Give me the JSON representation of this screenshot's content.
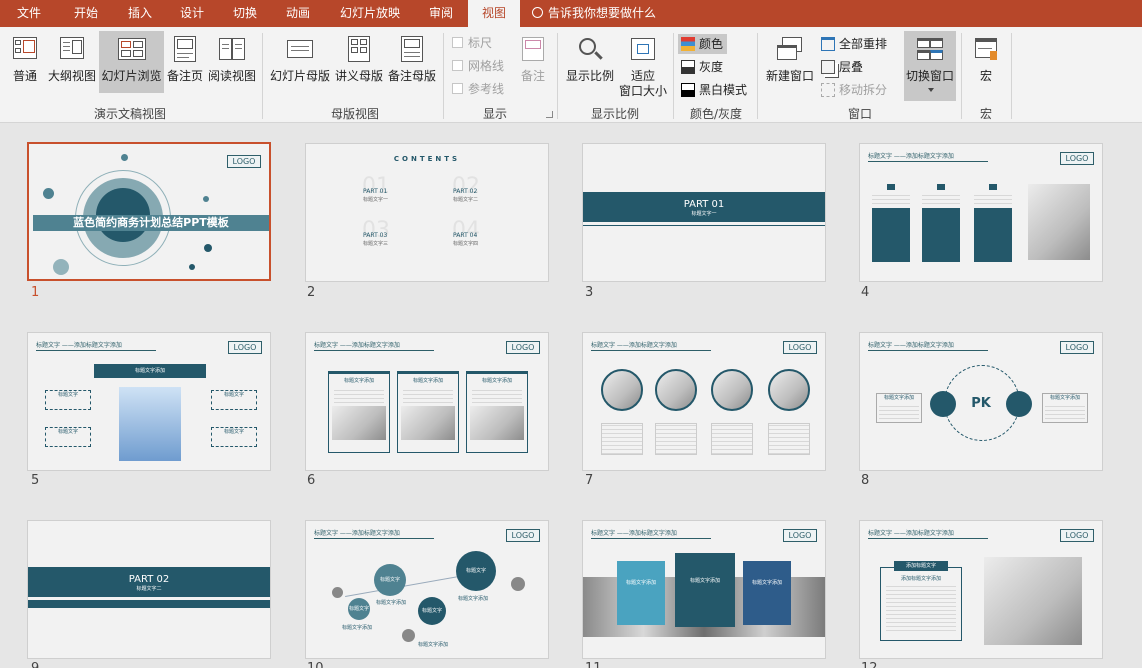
{
  "tabs": [
    "文件",
    "开始",
    "插入",
    "设计",
    "切换",
    "动画",
    "幻灯片放映",
    "审阅",
    "视图"
  ],
  "active_tab": "视图",
  "tell_me": "告诉我你想要做什么",
  "ribbon": {
    "views": {
      "normal": "普通",
      "outline": "大纲视图",
      "sorter": "幻灯片浏览",
      "notes": "备注页",
      "reading": "阅读视图",
      "group": "演示文稿视图"
    },
    "master": {
      "slide_master": "幻灯片母版",
      "handout_master": "讲义母版",
      "notes_master": "备注母版",
      "group": "母版视图"
    },
    "show": {
      "ruler": "标尺",
      "gridlines": "网格线",
      "guides": "参考线",
      "notes": "备注",
      "group": "显示"
    },
    "zoom": {
      "zoom": "显示比例",
      "fit": "适应\n窗口大小",
      "fit_l1": "适应",
      "fit_l2": "窗口大小",
      "group": "显示比例"
    },
    "color": {
      "color": "颜色",
      "grayscale": "灰度",
      "bw": "黑白模式",
      "group": "颜色/灰度"
    },
    "window": {
      "new_window": "新建窗口",
      "arrange_all": "全部重排",
      "cascade": "层叠",
      "move_split": "移动拆分",
      "switch": "切换窗口",
      "group": "窗口"
    },
    "macros": {
      "macros": "宏",
      "group": "宏"
    }
  },
  "slides": [
    {
      "num": "1",
      "title": "蓝色简约商务计划总结PPT模板",
      "logo": "LOGO"
    },
    {
      "num": "2",
      "contents": "CONTENTS",
      "items": [
        {
          "big": "01",
          "part": "PART 01",
          "sub": "标题文字一"
        },
        {
          "big": "02",
          "part": "PART 02",
          "sub": "标题文字二"
        },
        {
          "big": "03",
          "part": "PART 03",
          "sub": "标题文字三"
        },
        {
          "big": "04",
          "part": "PART 04",
          "sub": "标题文字四"
        }
      ]
    },
    {
      "num": "3",
      "part": "PART 01",
      "sub": "标题文字一"
    },
    {
      "num": "4",
      "logo": "LOGO",
      "header": "标题文字 ——添加标题文字添加"
    },
    {
      "num": "5",
      "logo": "LOGO",
      "header": "标题文字 ——添加标题文字添加",
      "center": "标题文字添加",
      "box": "标题文字"
    },
    {
      "num": "6",
      "logo": "LOGO",
      "header": "标题文字 ——添加标题文字添加",
      "card": "标题文字添加"
    },
    {
      "num": "7",
      "logo": "LOGO",
      "header": "标题文字 ——添加标题文字添加",
      "card": "标题文字添加"
    },
    {
      "num": "8",
      "logo": "LOGO",
      "header": "标题文字 ——添加标题文字添加",
      "pk": "PK",
      "side": "标题文字添加"
    },
    {
      "num": "9",
      "part": "PART 02",
      "sub": "标题文字二"
    },
    {
      "num": "10",
      "logo": "LOGO",
      "header": "标题文字 ——添加标题文字添加",
      "bubble": "标题文字",
      "label": "标题文字添加"
    },
    {
      "num": "11",
      "logo": "LOGO",
      "header": "标题文字 ——添加标题文字添加",
      "card": "标题文字添加"
    },
    {
      "num": "12",
      "logo": "LOGO",
      "header": "标题文字 ——添加标题文字添加",
      "card": "添加标题文字",
      "subcard": "添加标题文字添加"
    }
  ]
}
